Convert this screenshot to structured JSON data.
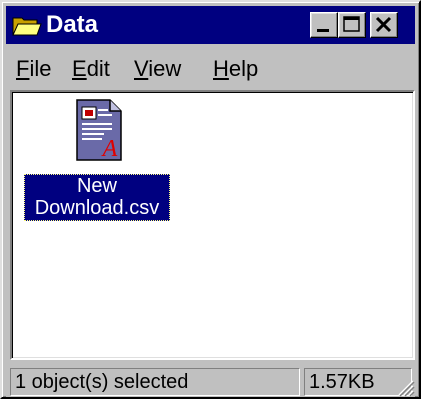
{
  "window": {
    "title": "Data",
    "title_icon": "folder-open-icon",
    "controls": [
      "minimize-icon",
      "maximize-icon",
      "close-icon"
    ]
  },
  "menu": {
    "items": [
      {
        "label": "File"
      },
      {
        "label": "Edit"
      },
      {
        "label": "View"
      },
      {
        "label": "Help"
      }
    ]
  },
  "content": {
    "files": [
      {
        "name_line1": "New",
        "name_line2": "Download.csv",
        "icon": "csv-document-icon",
        "selected": true
      }
    ]
  },
  "status": {
    "message": "1 object(s) selected",
    "size": "1.57KB"
  },
  "colors": {
    "title_bar": "#000080",
    "face": "#c0c0c0",
    "selection": "#000080"
  }
}
